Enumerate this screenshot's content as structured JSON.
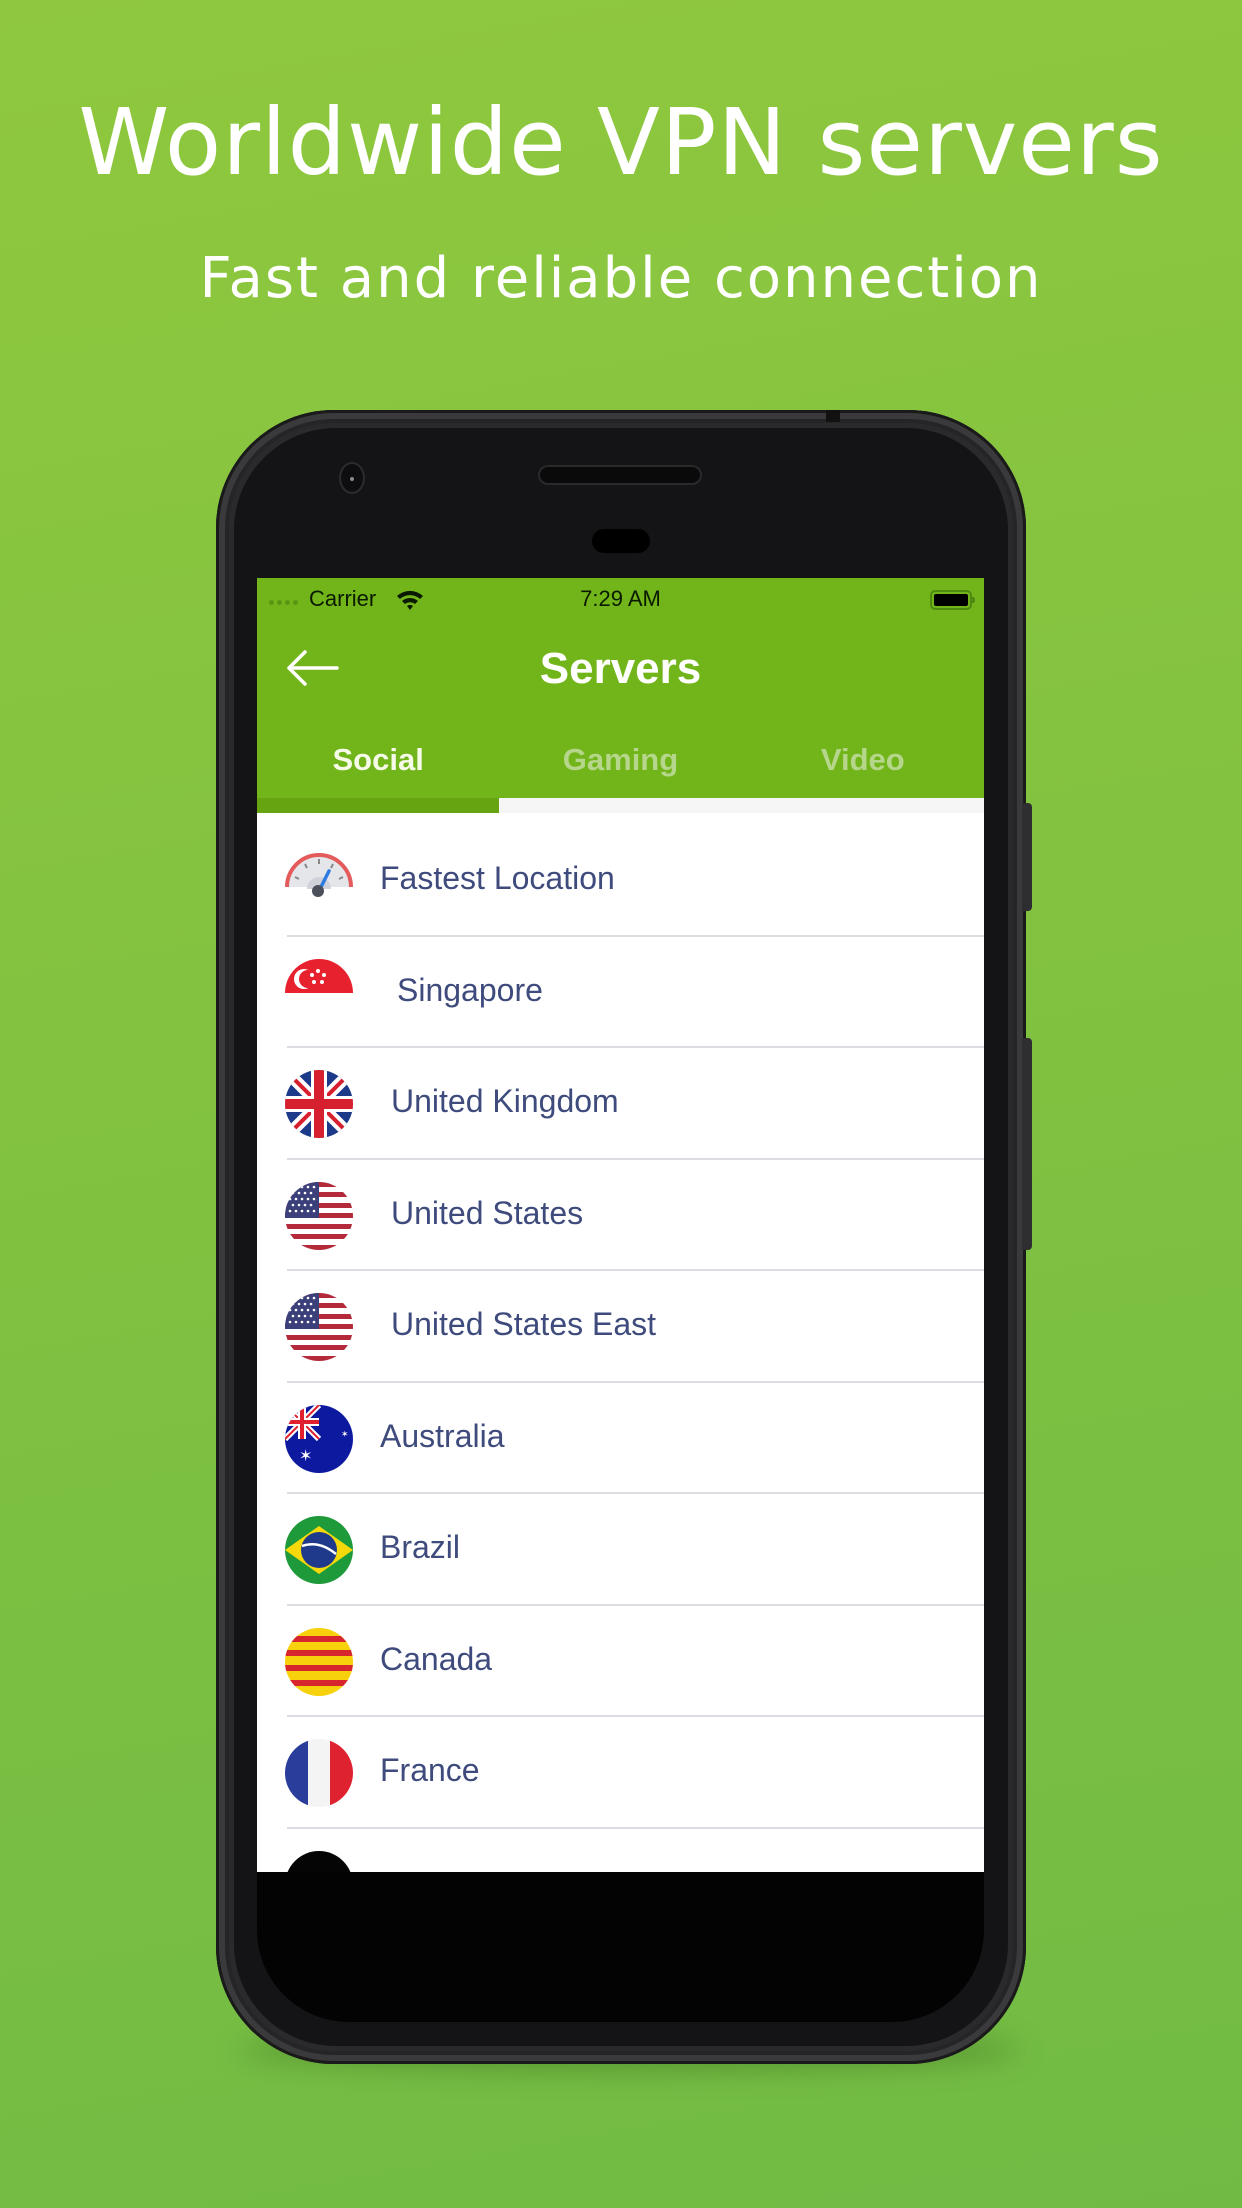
{
  "promo": {
    "headline": "Worldwide VPN servers",
    "subheadline": "Fast and reliable connection"
  },
  "colors": {
    "background_top": "#8fc83e",
    "background_bottom": "#71bb44",
    "app_bar": "#72b51a",
    "tab_indicator": "#66a511",
    "list_text": "#3e4b7c"
  },
  "status_bar": {
    "carrier": "Carrier",
    "time": "7:29 AM"
  },
  "app_bar": {
    "back_icon": "arrow-left-icon",
    "title": "Servers"
  },
  "tabs": [
    {
      "label": "Social",
      "active": true
    },
    {
      "label": "Gaming",
      "active": false
    },
    {
      "label": "Video",
      "active": false
    }
  ],
  "servers": [
    {
      "name": "Fastest Location",
      "icon": "speedometer-icon"
    },
    {
      "name": "Singapore",
      "icon": "flag-singapore-icon"
    },
    {
      "name": "United Kingdom",
      "icon": "flag-uk-icon"
    },
    {
      "name": "United States",
      "icon": "flag-us-icon"
    },
    {
      "name": "United States East",
      "icon": "flag-us-icon"
    },
    {
      "name": "Australia",
      "icon": "flag-australia-icon"
    },
    {
      "name": "Brazil",
      "icon": "flag-brazil-icon"
    },
    {
      "name": "Canada",
      "icon": "flag-canada-icon"
    },
    {
      "name": "France",
      "icon": "flag-france-icon"
    }
  ]
}
